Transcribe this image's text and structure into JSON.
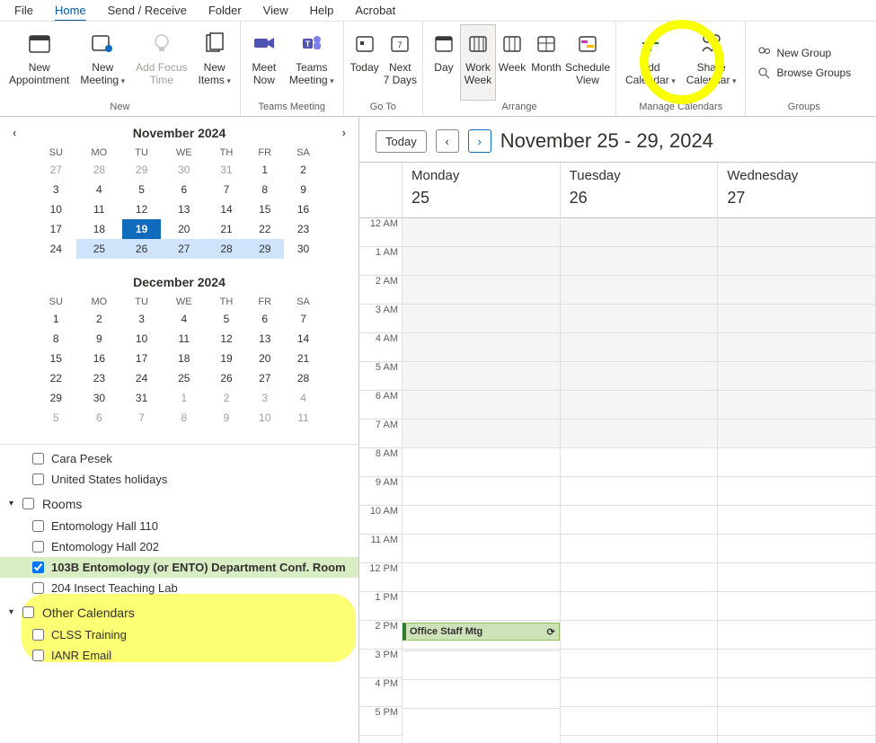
{
  "menu": {
    "file": "File",
    "home": "Home",
    "sendrecv": "Send / Receive",
    "folder": "Folder",
    "view": "View",
    "help": "Help",
    "acrobat": "Acrobat"
  },
  "ribbon": {
    "new_group": "New",
    "new_appt": "New\nAppointment",
    "new_meeting": "New\nMeeting",
    "add_focus": "Add Focus\nTime",
    "new_items": "New\nItems",
    "teams_group": "Teams Meeting",
    "meet_now": "Meet\nNow",
    "teams_meeting": "Teams\nMeeting",
    "goto_group": "Go To",
    "today": "Today",
    "next7": "Next\n7 Days",
    "arrange_group": "Arrange",
    "day": "Day",
    "workweek": "Work\nWeek",
    "week": "Week",
    "month": "Month",
    "schedview": "Schedule\nView",
    "manage_group": "Manage Calendars",
    "add_cal": "Add\nCalendar",
    "share_cal": "Share\nCalendar",
    "groups_group": "Groups",
    "new_group_btn": "New Group",
    "browse_groups": "Browse Groups"
  },
  "minical1": {
    "title": "November 2024",
    "dow": [
      "SU",
      "MO",
      "TU",
      "WE",
      "TH",
      "FR",
      "SA"
    ],
    "rows": [
      [
        {
          "n": "27",
          "d": 1
        },
        {
          "n": "28",
          "d": 1
        },
        {
          "n": "29",
          "d": 1
        },
        {
          "n": "30",
          "d": 1
        },
        {
          "n": "31",
          "d": 1
        },
        {
          "n": "1"
        },
        {
          "n": "2"
        }
      ],
      [
        {
          "n": "3"
        },
        {
          "n": "4"
        },
        {
          "n": "5"
        },
        {
          "n": "6"
        },
        {
          "n": "7"
        },
        {
          "n": "8"
        },
        {
          "n": "9"
        }
      ],
      [
        {
          "n": "10"
        },
        {
          "n": "11"
        },
        {
          "n": "12"
        },
        {
          "n": "13"
        },
        {
          "n": "14"
        },
        {
          "n": "15"
        },
        {
          "n": "16"
        }
      ],
      [
        {
          "n": "17"
        },
        {
          "n": "18"
        },
        {
          "n": "19",
          "t": 1
        },
        {
          "n": "20"
        },
        {
          "n": "21"
        },
        {
          "n": "22"
        },
        {
          "n": "23"
        }
      ],
      [
        {
          "n": "24"
        },
        {
          "n": "25",
          "s": 1
        },
        {
          "n": "26",
          "s": 1
        },
        {
          "n": "27",
          "s": 1
        },
        {
          "n": "28",
          "s": 1
        },
        {
          "n": "29",
          "s": 1
        },
        {
          "n": "30"
        }
      ]
    ]
  },
  "minical2": {
    "title": "December 2024",
    "dow": [
      "SU",
      "MO",
      "TU",
      "WE",
      "TH",
      "FR",
      "SA"
    ],
    "rows": [
      [
        {
          "n": "1"
        },
        {
          "n": "2"
        },
        {
          "n": "3"
        },
        {
          "n": "4"
        },
        {
          "n": "5"
        },
        {
          "n": "6"
        },
        {
          "n": "7"
        }
      ],
      [
        {
          "n": "8"
        },
        {
          "n": "9"
        },
        {
          "n": "10"
        },
        {
          "n": "11"
        },
        {
          "n": "12"
        },
        {
          "n": "13"
        },
        {
          "n": "14"
        }
      ],
      [
        {
          "n": "15"
        },
        {
          "n": "16"
        },
        {
          "n": "17"
        },
        {
          "n": "18"
        },
        {
          "n": "19"
        },
        {
          "n": "20"
        },
        {
          "n": "21"
        }
      ],
      [
        {
          "n": "22"
        },
        {
          "n": "23"
        },
        {
          "n": "24"
        },
        {
          "n": "25"
        },
        {
          "n": "26"
        },
        {
          "n": "27"
        },
        {
          "n": "28"
        }
      ],
      [
        {
          "n": "29"
        },
        {
          "n": "30"
        },
        {
          "n": "31"
        },
        {
          "n": "1",
          "d": 1
        },
        {
          "n": "2",
          "d": 1
        },
        {
          "n": "3",
          "d": 1
        },
        {
          "n": "4",
          "d": 1
        }
      ],
      [
        {
          "n": "5",
          "d": 1
        },
        {
          "n": "6",
          "d": 1
        },
        {
          "n": "7",
          "d": 1
        },
        {
          "n": "8",
          "d": 1
        },
        {
          "n": "9",
          "d": 1
        },
        {
          "n": "10",
          "d": 1
        },
        {
          "n": "11",
          "d": 1
        }
      ]
    ]
  },
  "calendars": {
    "items": [
      "Cara Pesek",
      "United States holidays"
    ],
    "rooms_label": "Rooms",
    "rooms": [
      "Entomology Hall 110",
      "Entomology Hall 202",
      "103B Entomology (or ENTO) Department Conf. Room",
      "204 Insect Teaching Lab"
    ],
    "rooms_checked_index": 2,
    "other_label": "Other Calendars",
    "other": [
      "CLSS Training",
      "IANR Email"
    ]
  },
  "header": {
    "today": "Today",
    "title": "November 25 - 29, 2024"
  },
  "columns": [
    {
      "name": "Monday",
      "num": "25"
    },
    {
      "name": "Tuesday",
      "num": "26"
    },
    {
      "name": "Wednesday",
      "num": "27"
    }
  ],
  "times": [
    "12 AM",
    "1 AM",
    "2 AM",
    "3 AM",
    "4 AM",
    "5 AM",
    "6 AM",
    "7 AM",
    "8 AM",
    "9 AM",
    "10 AM",
    "11 AM",
    "12 PM",
    "1 PM",
    "2 PM",
    "3 PM",
    "4 PM",
    "5 PM"
  ],
  "shade_until_index": 8,
  "event": {
    "title": "Office Staff Mtg",
    "time_index": 15
  }
}
